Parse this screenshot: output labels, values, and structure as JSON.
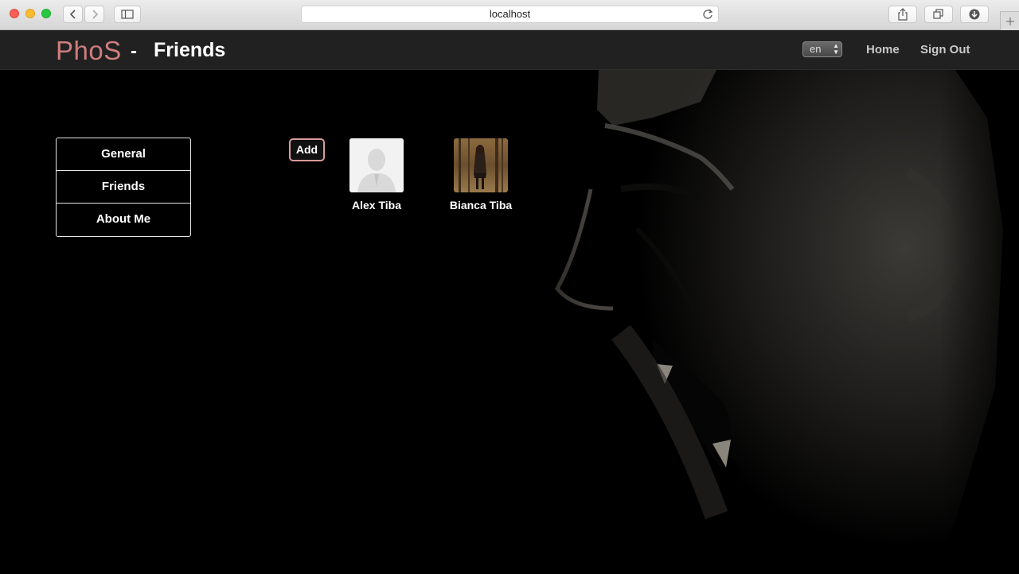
{
  "browser": {
    "url": "localhost"
  },
  "header": {
    "brand": "PhoS",
    "separator": "-",
    "page_title": "Friends",
    "language": {
      "selected": "en"
    },
    "nav": {
      "home": "Home",
      "sign_out": "Sign Out"
    }
  },
  "sidebar": {
    "items": [
      {
        "label": "General"
      },
      {
        "label": "Friends"
      },
      {
        "label": "About Me"
      }
    ]
  },
  "main": {
    "add_label": "Add",
    "friends": [
      {
        "name": "Alex Tiba",
        "avatar": "default-silhouette"
      },
      {
        "name": "Bianca Tiba",
        "avatar": "photo-woman-forest"
      }
    ]
  },
  "colors": {
    "brand": "#d07d7d",
    "navbar": "#212121",
    "add_border": "#d99a9a"
  }
}
